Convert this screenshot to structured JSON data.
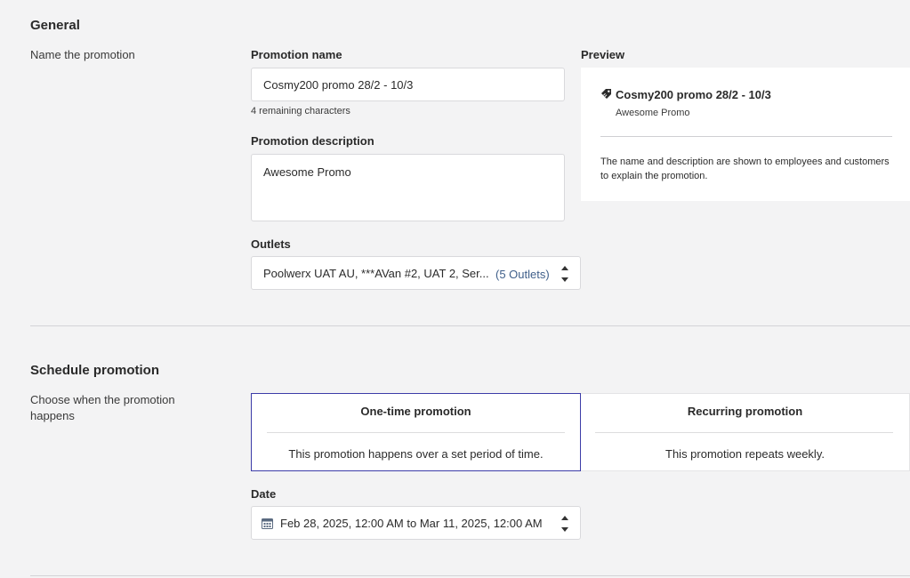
{
  "general": {
    "title": "General",
    "description": "Name the promotion",
    "promotion_name": {
      "label": "Promotion name",
      "value": "Cosmy200 promo 28/2 - 10/3",
      "hint": "4 remaining characters"
    },
    "promotion_description": {
      "label": "Promotion description",
      "value": "Awesome Promo"
    },
    "outlets": {
      "label": "Outlets",
      "value": "Poolwerx UAT AU, ***AVan #2, UAT 2, Ser...",
      "count": "(5 Outlets)"
    },
    "preview": {
      "label": "Preview",
      "icon": "tag-icon",
      "name": "Cosmy200 promo 28/2 - 10/3",
      "subtitle": "Awesome Promo",
      "note": "The name and description are shown to employees and customers to explain the promotion."
    }
  },
  "schedule": {
    "title": "Schedule promotion",
    "description": "Choose when the promotion happens",
    "options": [
      {
        "title": "One-time promotion",
        "desc": "This promotion happens over a set period of time.",
        "selected": true
      },
      {
        "title": "Recurring promotion",
        "desc": "This promotion repeats weekly.",
        "selected": false
      }
    ],
    "date": {
      "label": "Date",
      "icon": "calendar-icon",
      "value": "Feb 28, 2025, 12:00 AM to Mar 11, 2025, 12:00 AM"
    }
  },
  "colors": {
    "selected_border": "#3c3ca8",
    "link": "#3f5f8a",
    "background": "#f3f3f4"
  }
}
